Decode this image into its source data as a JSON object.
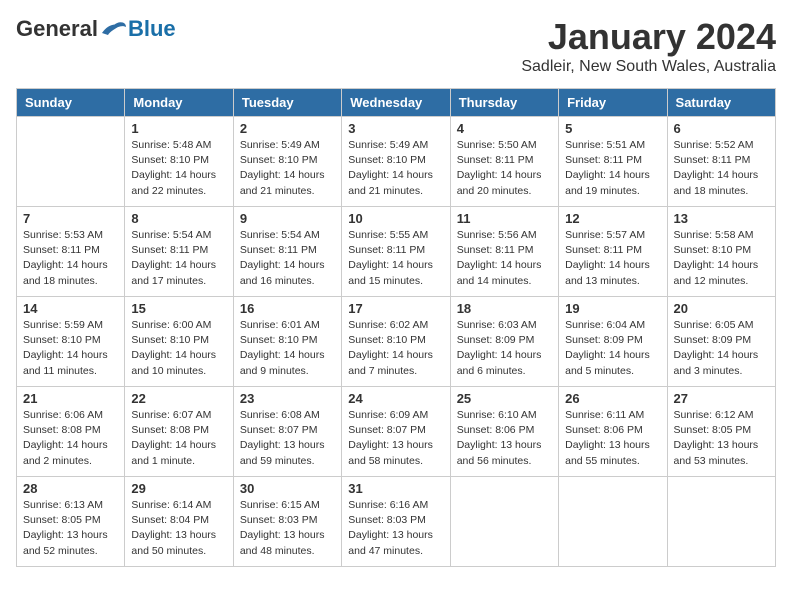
{
  "logo": {
    "general": "General",
    "blue": "Blue"
  },
  "title": "January 2024",
  "subtitle": "Sadleir, New South Wales, Australia",
  "weekdays": [
    "Sunday",
    "Monday",
    "Tuesday",
    "Wednesday",
    "Thursday",
    "Friday",
    "Saturday"
  ],
  "weeks": [
    [
      {
        "day": "",
        "info": ""
      },
      {
        "day": "1",
        "info": "Sunrise: 5:48 AM\nSunset: 8:10 PM\nDaylight: 14 hours\nand 22 minutes."
      },
      {
        "day": "2",
        "info": "Sunrise: 5:49 AM\nSunset: 8:10 PM\nDaylight: 14 hours\nand 21 minutes."
      },
      {
        "day": "3",
        "info": "Sunrise: 5:49 AM\nSunset: 8:10 PM\nDaylight: 14 hours\nand 21 minutes."
      },
      {
        "day": "4",
        "info": "Sunrise: 5:50 AM\nSunset: 8:11 PM\nDaylight: 14 hours\nand 20 minutes."
      },
      {
        "day": "5",
        "info": "Sunrise: 5:51 AM\nSunset: 8:11 PM\nDaylight: 14 hours\nand 19 minutes."
      },
      {
        "day": "6",
        "info": "Sunrise: 5:52 AM\nSunset: 8:11 PM\nDaylight: 14 hours\nand 18 minutes."
      }
    ],
    [
      {
        "day": "7",
        "info": "Sunrise: 5:53 AM\nSunset: 8:11 PM\nDaylight: 14 hours\nand 18 minutes."
      },
      {
        "day": "8",
        "info": "Sunrise: 5:54 AM\nSunset: 8:11 PM\nDaylight: 14 hours\nand 17 minutes."
      },
      {
        "day": "9",
        "info": "Sunrise: 5:54 AM\nSunset: 8:11 PM\nDaylight: 14 hours\nand 16 minutes."
      },
      {
        "day": "10",
        "info": "Sunrise: 5:55 AM\nSunset: 8:11 PM\nDaylight: 14 hours\nand 15 minutes."
      },
      {
        "day": "11",
        "info": "Sunrise: 5:56 AM\nSunset: 8:11 PM\nDaylight: 14 hours\nand 14 minutes."
      },
      {
        "day": "12",
        "info": "Sunrise: 5:57 AM\nSunset: 8:11 PM\nDaylight: 14 hours\nand 13 minutes."
      },
      {
        "day": "13",
        "info": "Sunrise: 5:58 AM\nSunset: 8:10 PM\nDaylight: 14 hours\nand 12 minutes."
      }
    ],
    [
      {
        "day": "14",
        "info": "Sunrise: 5:59 AM\nSunset: 8:10 PM\nDaylight: 14 hours\nand 11 minutes."
      },
      {
        "day": "15",
        "info": "Sunrise: 6:00 AM\nSunset: 8:10 PM\nDaylight: 14 hours\nand 10 minutes."
      },
      {
        "day": "16",
        "info": "Sunrise: 6:01 AM\nSunset: 8:10 PM\nDaylight: 14 hours\nand 9 minutes."
      },
      {
        "day": "17",
        "info": "Sunrise: 6:02 AM\nSunset: 8:10 PM\nDaylight: 14 hours\nand 7 minutes."
      },
      {
        "day": "18",
        "info": "Sunrise: 6:03 AM\nSunset: 8:09 PM\nDaylight: 14 hours\nand 6 minutes."
      },
      {
        "day": "19",
        "info": "Sunrise: 6:04 AM\nSunset: 8:09 PM\nDaylight: 14 hours\nand 5 minutes."
      },
      {
        "day": "20",
        "info": "Sunrise: 6:05 AM\nSunset: 8:09 PM\nDaylight: 14 hours\nand 3 minutes."
      }
    ],
    [
      {
        "day": "21",
        "info": "Sunrise: 6:06 AM\nSunset: 8:08 PM\nDaylight: 14 hours\nand 2 minutes."
      },
      {
        "day": "22",
        "info": "Sunrise: 6:07 AM\nSunset: 8:08 PM\nDaylight: 14 hours\nand 1 minute."
      },
      {
        "day": "23",
        "info": "Sunrise: 6:08 AM\nSunset: 8:07 PM\nDaylight: 13 hours\nand 59 minutes."
      },
      {
        "day": "24",
        "info": "Sunrise: 6:09 AM\nSunset: 8:07 PM\nDaylight: 13 hours\nand 58 minutes."
      },
      {
        "day": "25",
        "info": "Sunrise: 6:10 AM\nSunset: 8:06 PM\nDaylight: 13 hours\nand 56 minutes."
      },
      {
        "day": "26",
        "info": "Sunrise: 6:11 AM\nSunset: 8:06 PM\nDaylight: 13 hours\nand 55 minutes."
      },
      {
        "day": "27",
        "info": "Sunrise: 6:12 AM\nSunset: 8:05 PM\nDaylight: 13 hours\nand 53 minutes."
      }
    ],
    [
      {
        "day": "28",
        "info": "Sunrise: 6:13 AM\nSunset: 8:05 PM\nDaylight: 13 hours\nand 52 minutes."
      },
      {
        "day": "29",
        "info": "Sunrise: 6:14 AM\nSunset: 8:04 PM\nDaylight: 13 hours\nand 50 minutes."
      },
      {
        "day": "30",
        "info": "Sunrise: 6:15 AM\nSunset: 8:03 PM\nDaylight: 13 hours\nand 48 minutes."
      },
      {
        "day": "31",
        "info": "Sunrise: 6:16 AM\nSunset: 8:03 PM\nDaylight: 13 hours\nand 47 minutes."
      },
      {
        "day": "",
        "info": ""
      },
      {
        "day": "",
        "info": ""
      },
      {
        "day": "",
        "info": ""
      }
    ]
  ]
}
